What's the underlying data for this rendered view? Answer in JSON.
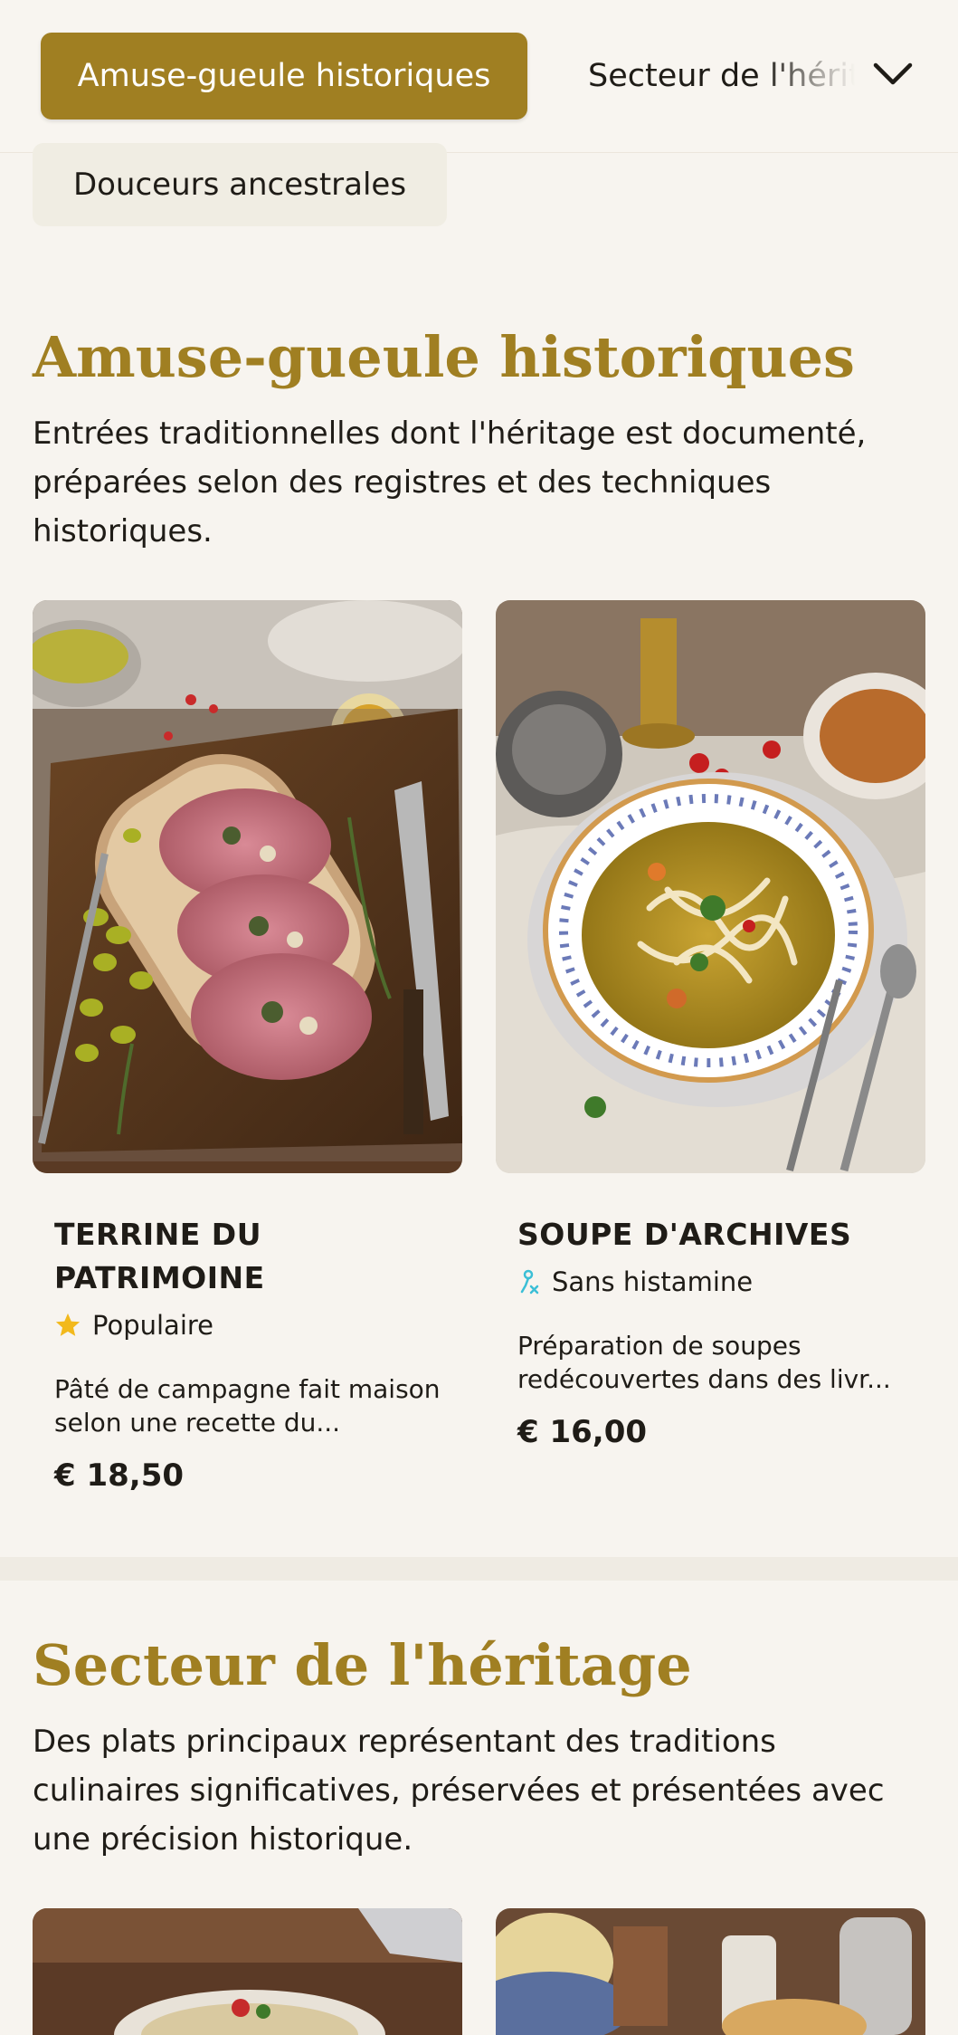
{
  "nav": {
    "active_tab": "Amuse-gueule historiques",
    "next_tab": "Secteur de l'héritage",
    "secondary_tab": "Douceurs ancestrales",
    "dropdown_icon": "chevron-down-icon"
  },
  "section1": {
    "title": "Amuse-gueule historiques",
    "description": "Entrées traditionnelles dont l'héritage est documenté, préparées selon des registres et des techniques historiques.",
    "items": [
      {
        "name": "TERRINE DU PATRIMOINE",
        "badge_icon": "star-icon",
        "badge": "Populaire",
        "description": "Pâté de campagne fait maison selon une recette du...",
        "price": "€ 18,50"
      },
      {
        "name": "SOUPE D'ARCHIVES",
        "badge_icon": "histamine-free-icon",
        "badge": "Sans histamine",
        "description": "Préparation de soupes redécouvertes dans des livr...",
        "price": "€ 16,00"
      }
    ]
  },
  "section2": {
    "title": "Secteur de l'héritage",
    "description": "Des plats principaux représentant des traditions culinaires significatives, préservées et présentées avec une précision historique."
  },
  "colors": {
    "accent": "#a07f22",
    "background": "#f7f4ef",
    "star": "#f2b91c",
    "histamine_icon": "#3bbfd6"
  }
}
